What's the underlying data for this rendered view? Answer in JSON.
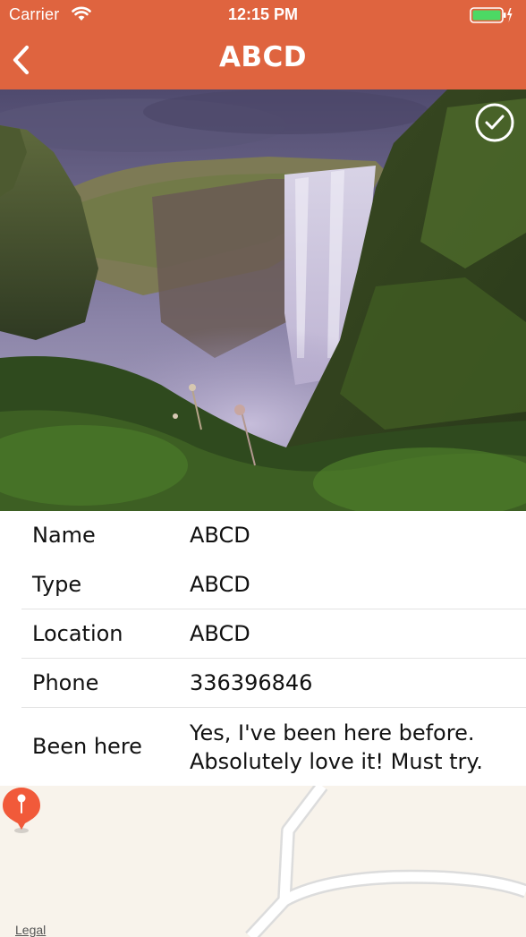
{
  "status_bar": {
    "carrier": "Carrier",
    "time": "12:15 PM",
    "icons": [
      "wifi-icon",
      "battery-icon",
      "charging-bolt-icon"
    ]
  },
  "nav": {
    "title": "ABCD",
    "back_icon": "chevron-left-icon",
    "bar_color": "#DF643F"
  },
  "hero": {
    "subject": "waterfall photo",
    "action_icon": "checkmark-circle-icon"
  },
  "details": {
    "rows": [
      {
        "label": "Name",
        "value": "ABCD"
      },
      {
        "label": "Type",
        "value": "ABCD"
      },
      {
        "label": "Location",
        "value": "ABCD"
      },
      {
        "label": "Phone",
        "value": "336396846"
      },
      {
        "label": "Been here",
        "value_line1": "Yes, I've been here before.",
        "value_line2": "Absolutely love it! Must try."
      }
    ]
  },
  "map": {
    "legal_label": "Legal",
    "pin_icon": "map-pin-icon",
    "pin_color": "#F15A3A",
    "background_color": "#F8F3EB"
  }
}
